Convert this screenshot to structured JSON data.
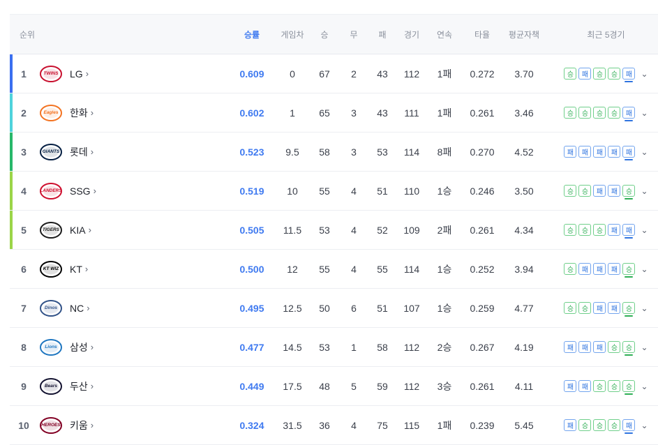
{
  "header": {
    "rank": "순위",
    "pct": "승률",
    "gb": "게임차",
    "w": "승",
    "d": "무",
    "l": "패",
    "g": "경기",
    "streak": "연속",
    "avg": "타율",
    "era": "평균자책",
    "recent": "최근 5경기"
  },
  "rows": [
    {
      "rank": "1",
      "team": "LG",
      "logo": "TWINS",
      "pct": "0.609",
      "gb": "0",
      "w": "67",
      "d": "2",
      "l": "43",
      "g": "112",
      "streak": "1패",
      "avg": "0.272",
      "era": "3.70",
      "recent": [
        "승",
        "패",
        "승",
        "승",
        "패"
      ]
    },
    {
      "rank": "2",
      "team": "한화",
      "logo": "Eagles",
      "pct": "0.602",
      "gb": "1",
      "w": "65",
      "d": "3",
      "l": "43",
      "g": "111",
      "streak": "1패",
      "avg": "0.261",
      "era": "3.46",
      "recent": [
        "승",
        "승",
        "승",
        "승",
        "패"
      ]
    },
    {
      "rank": "3",
      "team": "롯데",
      "logo": "GIANTS",
      "pct": "0.523",
      "gb": "9.5",
      "w": "58",
      "d": "3",
      "l": "53",
      "g": "114",
      "streak": "8패",
      "avg": "0.270",
      "era": "4.52",
      "recent": [
        "패",
        "패",
        "패",
        "패",
        "패"
      ]
    },
    {
      "rank": "4",
      "team": "SSG",
      "logo": "LANDERS",
      "pct": "0.519",
      "gb": "10",
      "w": "55",
      "d": "4",
      "l": "51",
      "g": "110",
      "streak": "1승",
      "avg": "0.246",
      "era": "3.50",
      "recent": [
        "승",
        "승",
        "패",
        "패",
        "승"
      ]
    },
    {
      "rank": "5",
      "team": "KIA",
      "logo": "TIGERS",
      "pct": "0.505",
      "gb": "11.5",
      "w": "53",
      "d": "4",
      "l": "52",
      "g": "109",
      "streak": "2패",
      "avg": "0.261",
      "era": "4.34",
      "recent": [
        "승",
        "승",
        "승",
        "패",
        "패"
      ]
    },
    {
      "rank": "6",
      "team": "KT",
      "logo": "KT WIZ",
      "pct": "0.500",
      "gb": "12",
      "w": "55",
      "d": "4",
      "l": "55",
      "g": "114",
      "streak": "1승",
      "avg": "0.252",
      "era": "3.94",
      "recent": [
        "승",
        "패",
        "패",
        "패",
        "승"
      ]
    },
    {
      "rank": "7",
      "team": "NC",
      "logo": "Dinos",
      "pct": "0.495",
      "gb": "12.5",
      "w": "50",
      "d": "6",
      "l": "51",
      "g": "107",
      "streak": "1승",
      "avg": "0.259",
      "era": "4.77",
      "recent": [
        "승",
        "승",
        "패",
        "패",
        "승"
      ]
    },
    {
      "rank": "8",
      "team": "삼성",
      "logo": "Lions",
      "pct": "0.477",
      "gb": "14.5",
      "w": "53",
      "d": "1",
      "l": "58",
      "g": "112",
      "streak": "2승",
      "avg": "0.267",
      "era": "4.19",
      "recent": [
        "패",
        "패",
        "패",
        "승",
        "승"
      ]
    },
    {
      "rank": "9",
      "team": "두산",
      "logo": "Bears",
      "pct": "0.449",
      "gb": "17.5",
      "w": "48",
      "d": "5",
      "l": "59",
      "g": "112",
      "streak": "3승",
      "avg": "0.261",
      "era": "4.11",
      "recent": [
        "패",
        "패",
        "승",
        "승",
        "승"
      ]
    },
    {
      "rank": "10",
      "team": "키움",
      "logo": "HEROES",
      "pct": "0.324",
      "gb": "31.5",
      "w": "36",
      "d": "4",
      "l": "75",
      "g": "115",
      "streak": "1패",
      "avg": "0.239",
      "era": "5.45",
      "recent": [
        "패",
        "승",
        "승",
        "승",
        "패"
      ]
    }
  ],
  "zone_colors": {
    "first": "#3a6ff0",
    "po": "#4fd3dc",
    "semi": "#28b86a",
    "wildcard": "#9bd548"
  },
  "logo_colors": {
    "LG": "#c8102e",
    "한화": "#f37321",
    "롯데": "#041e42",
    "SSG": "#ce0e2d",
    "KIA": "#1a1a1a",
    "KT": "#000000",
    "NC": "#315288",
    "삼성": "#1e76c0",
    "두산": "#131230",
    "키움": "#820024"
  }
}
